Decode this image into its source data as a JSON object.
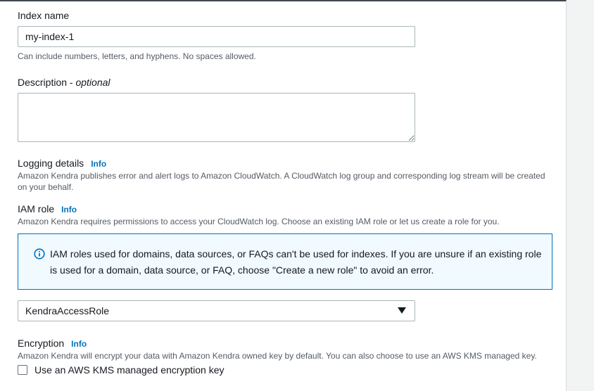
{
  "index_name": {
    "label": "Index name",
    "value": "my-index-1",
    "hint": "Can include numbers, letters, and hyphens. No spaces allowed."
  },
  "description": {
    "label": "Description - ",
    "optional": "optional",
    "value": ""
  },
  "logging": {
    "label": "Logging details",
    "info": "Info",
    "hint": "Amazon Kendra publishes error and alert logs to Amazon CloudWatch. A CloudWatch log group and corresponding log stream will be created on your behalf."
  },
  "iam_role": {
    "label": "IAM role",
    "info": "Info",
    "hint": "Amazon Kendra requires permissions to access your CloudWatch log. Choose an existing IAM role or let us create a role for you.",
    "alert": "IAM roles used for domains, data sources, or FAQs can't be used for indexes. If you are unsure if an existing role is used for a domain, data source, or FAQ, choose \"Create a new role\" to avoid an error.",
    "selected": "KendraAccessRole"
  },
  "encryption": {
    "label": "Encryption",
    "info": "Info",
    "hint": "Amazon Kendra will encrypt your data with Amazon Kendra owned key by default. You can also choose to use an AWS KMS managed key.",
    "checkbox_label": "Use an AWS KMS managed encryption key",
    "checked": false
  },
  "icons": {
    "alert": "info-circle-icon",
    "select": "caret-down-icon"
  },
  "colors": {
    "link": "#0073bb",
    "alert_border": "#0073bb",
    "alert_bg": "#f1faff"
  }
}
